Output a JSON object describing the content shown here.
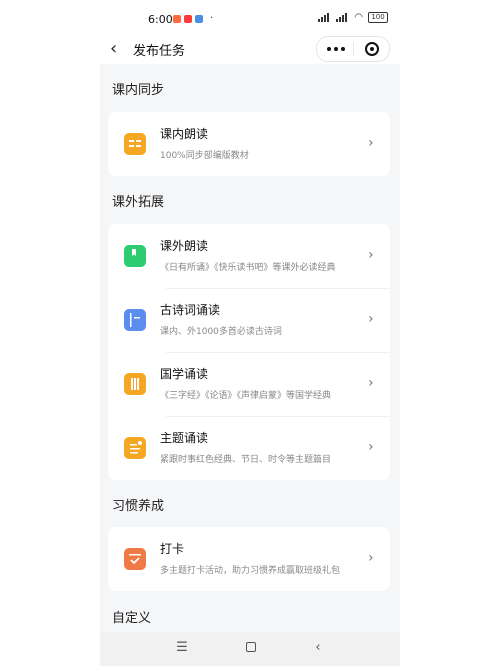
{
  "status_bar": {
    "time": "6:00",
    "dot": "·",
    "battery": "100"
  },
  "nav": {
    "title": "发布任务"
  },
  "sections": [
    {
      "title": "课内同步",
      "items": [
        {
          "title": "课内朗读",
          "desc": "100%同步部编版教材",
          "icon": "book-open-icon",
          "color": "#f5a623"
        }
      ]
    },
    {
      "title": "课外拓展",
      "items": [
        {
          "title": "课外朗读",
          "desc": "《日有所诵》《快乐读书吧》等课外必读经典",
          "icon": "bookmark-icon",
          "color": "#2ecc71"
        },
        {
          "title": "古诗词诵读",
          "desc": "课内、外1000多首必读古诗词",
          "icon": "notebook-icon",
          "color": "#5b8def"
        },
        {
          "title": "国学诵读",
          "desc": "《三字经》《论语》《声律启蒙》等国学经典",
          "icon": "scroll-icon",
          "color": "#f5a623"
        },
        {
          "title": "主题诵读",
          "desc": "紧跟时事红色经典、节日、时令等主题篇目",
          "icon": "document-icon",
          "color": "#f5a623"
        }
      ]
    },
    {
      "title": "习惯养成",
      "items": [
        {
          "title": "打卡",
          "desc": "多主题打卡活动，助力习惯养成赢取班级礼包",
          "icon": "calendar-check-icon",
          "color": "#f07a45"
        }
      ]
    },
    {
      "title": "自定义",
      "items": []
    }
  ],
  "bottom_nav": {
    "menu_glyph": "☰",
    "back_glyph": "‹"
  }
}
